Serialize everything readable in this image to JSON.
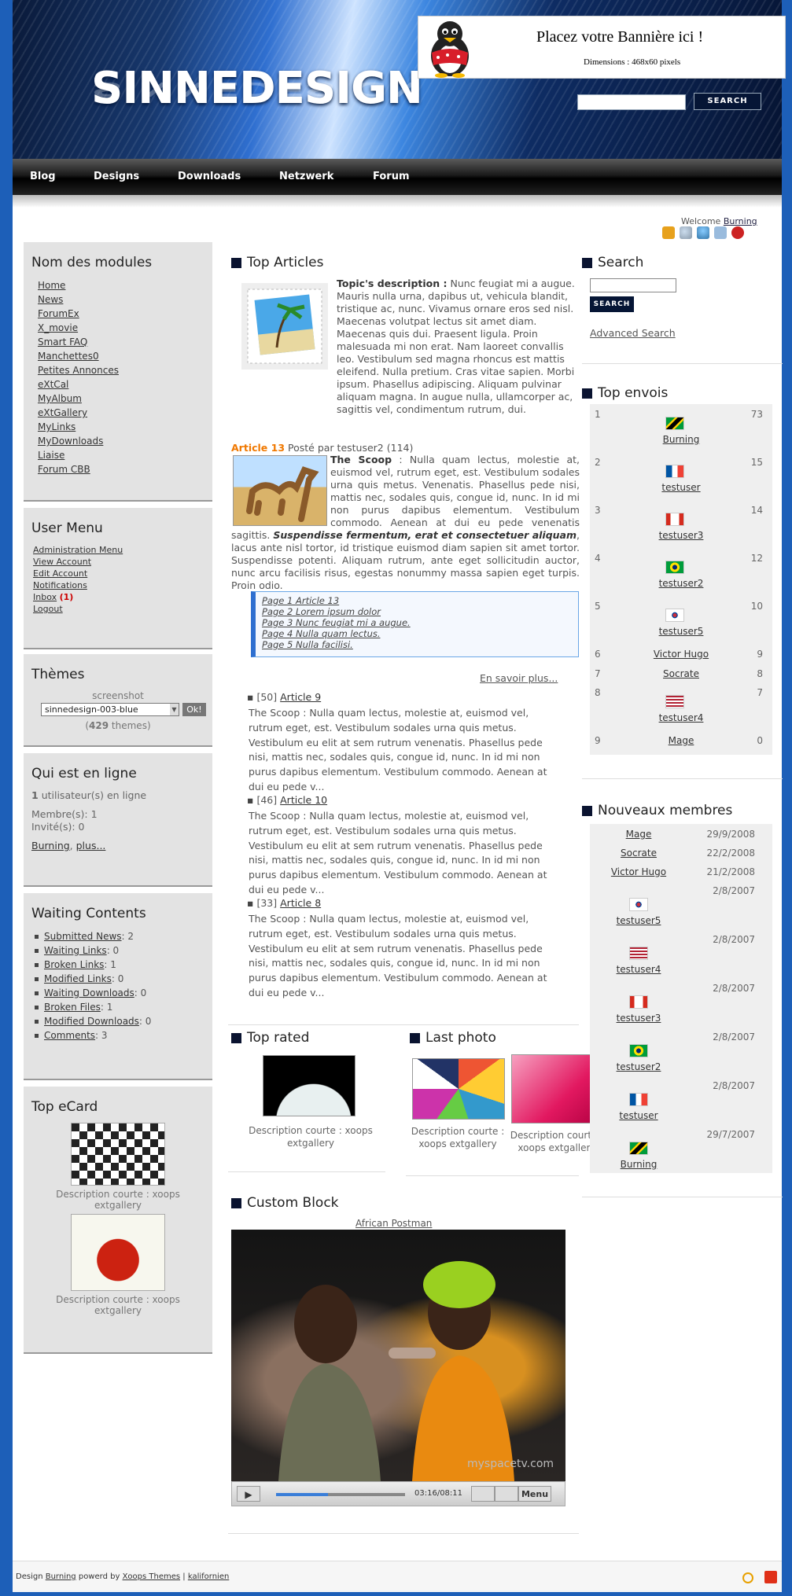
{
  "header": {
    "logo": "SINNEDESIGN",
    "banner_title": "Placez votre Bannière ici !",
    "banner_dims": "Dimensions : 468x60 pixels",
    "search_button": "Search",
    "welcome_prefix": "Welcome",
    "welcome_user": "Burning"
  },
  "nav": [
    "Blog",
    "Designs",
    "Downloads",
    "Netzwerk",
    "Forum"
  ],
  "left": {
    "modules_title": "Nom des modules",
    "modules": [
      "Home",
      "News",
      "ForumEx",
      "X_movie",
      "Smart FAQ",
      "Manchettes0",
      "Petites Annonces",
      "eXtCal",
      "MyAlbum",
      "eXtGallery",
      "MyLinks",
      "MyDownloads",
      "Liaise",
      "Forum CBB"
    ],
    "usermenu_title": "User Menu",
    "usermenu": [
      "Administration Menu",
      "View Account",
      "Edit Account",
      "Notifications",
      "Inbox",
      "Logout"
    ],
    "inbox_count": "1",
    "themes_title": "Thèmes",
    "themes_screenshot": "screenshot",
    "themes_select": "sinnedesign-003-blue",
    "themes_ok": "Ok!",
    "themes_count": "429",
    "themes_count_suffix": "themes",
    "online_title": "Qui est en ligne",
    "online_count": "1",
    "online_text": "utilisateur(s) en ligne",
    "members_label": "Membre(s): 1",
    "guests_label": "Invité(s): 0",
    "online_user": "Burning",
    "online_more": "plus...",
    "waiting_title": "Waiting Contents",
    "waiting": [
      {
        "label": "Submitted News",
        "count": "2"
      },
      {
        "label": "Waiting Links",
        "count": "0"
      },
      {
        "label": "Broken Links",
        "count": "1"
      },
      {
        "label": "Modified Links",
        "count": "0"
      },
      {
        "label": "Waiting Downloads",
        "count": "0"
      },
      {
        "label": "Broken Files",
        "count": "1"
      },
      {
        "label": "Modified Downloads",
        "count": "0"
      },
      {
        "label": "Comments",
        "count": "3"
      }
    ],
    "ecard_title": "Top eCard",
    "ecard_caption": "Description courte : xoops extgallery"
  },
  "center": {
    "top_articles": "Top Articles",
    "topic_label": "Topic's description :",
    "topic_text": "Nunc feugiat mi a augue. Mauris nulla urna, dapibus ut, vehicula blandit, tristique ac, nunc. Vivamus ornare eros sed nisl. Maecenas volutpat lectus sit amet diam. Maecenas quis dui. Praesent ligula. Proin malesuada mi non erat. Nam laoreet convallis leo. Vestibulum sed magna rhoncus est mattis eleifend. Nulla pretium. Cras vitae sapien. Morbi ipsum. Phasellus adipiscing. Aliquam pulvinar aliquam magna. In augue nulla, ullamcorper ac, sagittis vel, condimentum rutrum, dui.",
    "article_title": "Article 13",
    "article_meta": "Posté par testuser2 (114)",
    "scoop_label": "The Scoop",
    "scoop_text": ": Nulla quam lectus, molestie at, euismod vel, rutrum eget, est. Vestibulum sodales urna quis metus. Venenatis. Phasellus pede nisi, mattis nec, sodales quis, congue id, nunc. In id mi non purus dapibus elementum. Vestibulum commodo. Aenean at dui eu pede venenatis sagittis.",
    "scoop_em": "Suspendisse fermentum, erat et consectetuer aliquam",
    "scoop_tail": ", lacus ante nisl tortor, id tristique euismod diam sapien sit amet tortor. Suspendisse potenti. Aliquam rutrum, ante eget sollicitudin auctor, nunc arcu facilisis risus, egestas nonummy massa sapien eget turpis. Proin odio.",
    "pages": [
      "Page 1 Article 13",
      "Page 2 Lorem ipsum dolor",
      "Page 3 Nunc feugiat mi a augue.",
      "Page 4 Nulla quam lectus.",
      "Page 5 Nulla facilisi."
    ],
    "read_more": "En savoir plus...",
    "items": [
      {
        "count": "[50]",
        "title": "Article 9",
        "text": "The Scoop : Nulla quam lectus, molestie at, euismod vel, rutrum eget, est. Vestibulum sodales urna quis metus. Vestibulum eu elit at sem rutrum venenatis. Phasellus pede nisi, mattis nec, sodales quis, congue id, nunc. In id mi non purus dapibus elementum. Vestibulum commodo. Aenean at dui eu pede v..."
      },
      {
        "count": "[46]",
        "title": "Article 10",
        "text": "The Scoop : Nulla quam lectus, molestie at, euismod vel, rutrum eget, est. Vestibulum sodales urna quis metus. Vestibulum eu elit at sem rutrum venenatis. Phasellus pede nisi, mattis nec, sodales quis, congue id, nunc. In id mi non purus dapibus elementum. Vestibulum commodo. Aenean at dui eu pede v..."
      },
      {
        "count": "[33]",
        "title": "Article 8",
        "text": "The Scoop : Nulla quam lectus, molestie at, euismod vel, rutrum eget, est. Vestibulum sodales urna quis metus. Vestibulum eu elit at sem rutrum venenatis. Phasellus pede nisi, mattis nec, sodales quis, congue id, nunc. In id mi non purus dapibus elementum. Vestibulum commodo. Aenean at dui eu pede v..."
      }
    ],
    "top_rated": "Top rated",
    "last_photo": "Last photo",
    "gallery_caption": "Description courte : xoops extgallery",
    "custom_block": "Custom Block",
    "video_title": "African Postman",
    "video_time": "03:16/08:11",
    "video_menu": "Menu",
    "video_progress": 0.4,
    "video_watermark": "myspacetv.com"
  },
  "right": {
    "search_title": "Search",
    "search_button": "Search",
    "advanced_search": "Advanced Search",
    "top_posters_title": "Top envois",
    "top_posters": [
      {
        "rank": "1",
        "name": "Burning",
        "count": "73",
        "flag": "jm"
      },
      {
        "rank": "2",
        "name": "testuser",
        "count": "15",
        "flag": "fr"
      },
      {
        "rank": "3",
        "name": "testuser3",
        "count": "14",
        "flag": "ca"
      },
      {
        "rank": "4",
        "name": "testuser2",
        "count": "12",
        "flag": "br"
      },
      {
        "rank": "5",
        "name": "testuser5",
        "count": "10",
        "flag": "kr"
      },
      {
        "rank": "6",
        "name": "Victor Hugo",
        "count": "9",
        "flag": ""
      },
      {
        "rank": "7",
        "name": "Socrate",
        "count": "8",
        "flag": ""
      },
      {
        "rank": "8",
        "name": "testuser4",
        "count": "7",
        "flag": "us"
      },
      {
        "rank": "9",
        "name": "Mage",
        "count": "0",
        "flag": ""
      }
    ],
    "new_members_title": "Nouveaux membres",
    "new_members": [
      {
        "name": "Mage",
        "date": "29/9/2008",
        "flag": ""
      },
      {
        "name": "Socrate",
        "date": "22/2/2008",
        "flag": ""
      },
      {
        "name": "Victor Hugo",
        "date": "21/2/2008",
        "flag": ""
      },
      {
        "name": "testuser5",
        "date": "2/8/2007",
        "flag": "kr"
      },
      {
        "name": "testuser4",
        "date": "2/8/2007",
        "flag": "us"
      },
      {
        "name": "testuser3",
        "date": "2/8/2007",
        "flag": "ca"
      },
      {
        "name": "testuser2",
        "date": "2/8/2007",
        "flag": "br"
      },
      {
        "name": "testuser",
        "date": "2/8/2007",
        "flag": "fr"
      },
      {
        "name": "Burning",
        "date": "29/7/2007",
        "flag": "jm"
      }
    ]
  },
  "footer": {
    "design_prefix": "Design",
    "design_user": "Burning",
    "powered": "powerd by",
    "xoops_link": "Xoops Themes",
    "sep": "|",
    "kalif_link": "kalifornien"
  }
}
